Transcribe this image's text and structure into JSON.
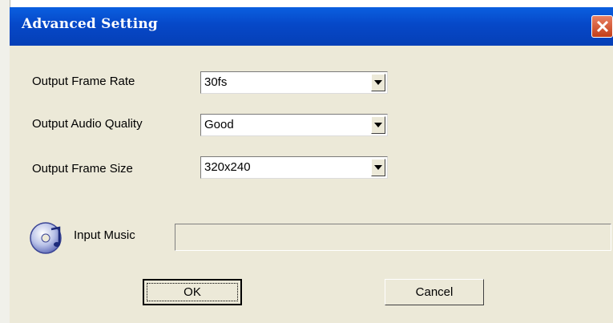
{
  "window": {
    "title": "Advanced Setting"
  },
  "settings": {
    "frame_rate": {
      "label": "Output Frame Rate",
      "value": "30fs"
    },
    "audio_quality": {
      "label": "Output Audio Quality",
      "value": "Good"
    },
    "frame_size": {
      "label": "Output Frame Size",
      "value": "320x240"
    }
  },
  "music": {
    "label": "Input Music",
    "value": ""
  },
  "buttons": {
    "ok": "OK",
    "cancel": "Cancel"
  },
  "icons": {
    "close": "close-icon",
    "dropdown": "chevron-down-icon",
    "music": "cd-music-icon"
  },
  "colors": {
    "titlebar": "#0648c8",
    "close": "#d5572f",
    "face": "#ece9d8"
  }
}
